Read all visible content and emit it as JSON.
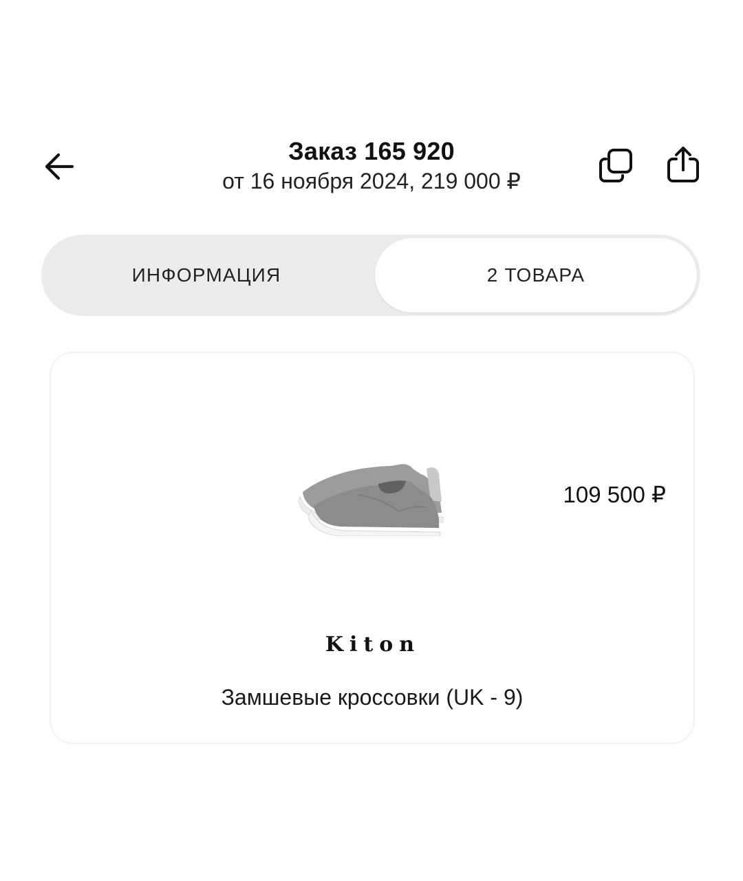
{
  "header": {
    "back_icon": "arrow-left-icon",
    "title": "Заказ 165 920",
    "subtitle": "от 16 ноября 2024, 219 000 ₽",
    "copy_icon": "copy-icon",
    "share_icon": "share-icon"
  },
  "tabs": {
    "info_label": "ИНФОРМАЦИЯ",
    "items_label": "2 ТОВАРА",
    "selected": "2 ТОВАРА"
  },
  "product": {
    "price": "109 500 ₽",
    "brand": "Kiton",
    "name": "Замшевые кроссовки (UK - 9)",
    "image_icon": "sneakers-image"
  },
  "colors": {
    "text": "#111111",
    "segment_bg": "#ececec",
    "card_border": "#f1f1f1",
    "shoe_suede": "#8e9190",
    "sole": "#f2f2f2"
  }
}
